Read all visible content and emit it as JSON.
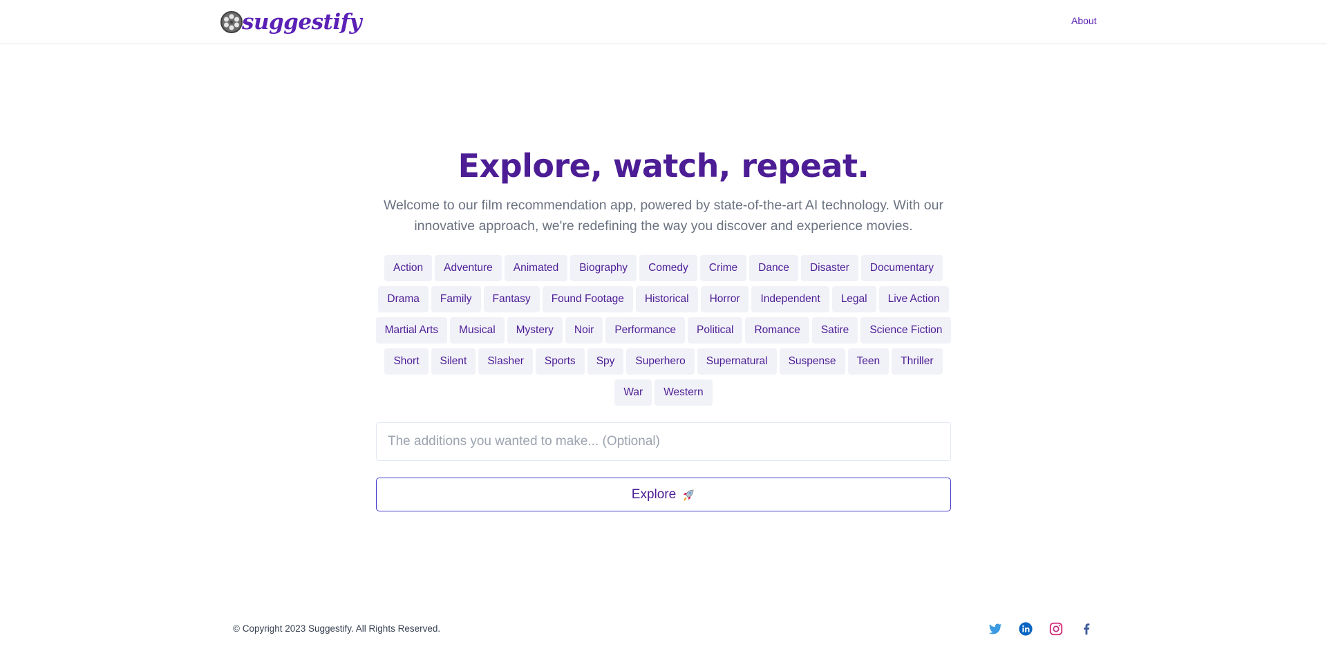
{
  "nav": {
    "brand": "suggestify",
    "about_label": "About"
  },
  "hero": {
    "title": "Explore, watch, repeat.",
    "subtitle": "Welcome to our film recommendation app, powered by state-of-the-art AI technology. With our innovative approach, we're redefining the way you discover and experience movies."
  },
  "genres": [
    "Action",
    "Adventure",
    "Animated",
    "Biography",
    "Comedy",
    "Crime",
    "Dance",
    "Disaster",
    "Documentary",
    "Drama",
    "Family",
    "Fantasy",
    "Found Footage",
    "Historical",
    "Horror",
    "Independent",
    "Legal",
    "Live Action",
    "Martial Arts",
    "Musical",
    "Mystery",
    "Noir",
    "Performance",
    "Political",
    "Romance",
    "Satire",
    "Science Fiction",
    "Short",
    "Silent",
    "Slasher",
    "Sports",
    "Spy",
    "Superhero",
    "Supernatural",
    "Suspense",
    "Teen",
    "Thriller",
    "War",
    "Western"
  ],
  "additions": {
    "placeholder": "The additions you wanted to make... (Optional)",
    "value": ""
  },
  "explore": {
    "label": "Explore",
    "icon": "rocket-icon"
  },
  "footer": {
    "copyright": "© Copyright 2023 Suggestify. All Rights Reserved.",
    "socials": [
      {
        "name": "twitter-icon",
        "color": "#3b9ae1"
      },
      {
        "name": "linkedin-icon",
        "color": "#0a66c2"
      },
      {
        "name": "instagram-icon",
        "color": "#d62976"
      },
      {
        "name": "facebook-icon",
        "color": "#3b5998"
      }
    ]
  },
  "colors": {
    "brand": "#5b21b6",
    "title": "#4c1d95",
    "chip_bg": "#f1f1f8",
    "button_border": "#4338ca"
  }
}
